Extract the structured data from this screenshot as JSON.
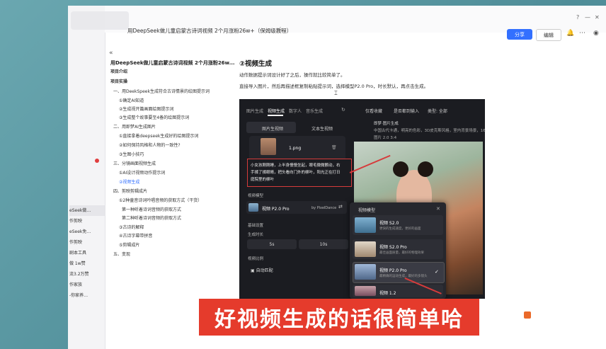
{
  "header": {
    "doc_title": "用DeepSeek做儿童启蒙古诗词视频 2个月涨粉26w+（保姆级教程）",
    "share": "分享",
    "edit": "编辑"
  },
  "sidebar": {
    "items": [
      "eSeek做…",
      "作剪映",
      "eSeek免…",
      "作剪映",
      "剧本工具",
      "做 1w赞",
      "流3.2万赞",
      "作家族",
      "-你家养…"
    ]
  },
  "toc": {
    "title": "用DeepSeek做儿童启蒙古诗词视频 2个月涨粉26w...",
    "items": [
      {
        "text": "项目介绍",
        "style": "bold"
      },
      {
        "text": "项目实操",
        "style": "bold"
      },
      {
        "text": "一、用DeekSpeek生成符合古诗情景的绘图提示词",
        "style": ""
      },
      {
        "text": "①确定AI知道",
        "style": ""
      },
      {
        "text": "②生成视开篇画面绘图提示词",
        "style": ""
      },
      {
        "text": "③生成整个故事要至4备的绘图提示词",
        "style": ""
      },
      {
        "text": "二、用即梦AI生成图片",
        "style": ""
      },
      {
        "text": "①直接拿着deepseek生成好的绘图提示词",
        "style": ""
      },
      {
        "text": "②如何保持风格和人物的一致性?",
        "style": ""
      },
      {
        "text": "③生图小技巧",
        "style": ""
      },
      {
        "text": "三、分镜画面视频生成",
        "style": ""
      },
      {
        "text": "①AI设计视频动作提示词",
        "style": ""
      },
      {
        "text": "②视频生成",
        "style": "active"
      },
      {
        "text": "四、剪映剪辑成片",
        "style": ""
      },
      {
        "text": "①2种童音诗词吟唱音频的获取方式（干货）",
        "style": ""
      },
      {
        "text": "第一种听着诗词音频的获取方式",
        "style": ""
      },
      {
        "text": "第二种听着诗词音频的获取方式",
        "style": ""
      },
      {
        "text": "③古诗的解释",
        "style": ""
      },
      {
        "text": "④古诗字幕带拼音",
        "style": ""
      },
      {
        "text": "⑤剪辑成片",
        "style": ""
      },
      {
        "text": "五、变现",
        "style": ""
      }
    ]
  },
  "content": {
    "heading": "②视频生成",
    "para1": "动作数据提示词设计好了之后，操作就比较简单了。",
    "para2": "直接导入图片，然后再描述框复制粘贴提示词，选择模型P2.0 Pro，时长默认，再点击生成。"
  },
  "shot": {
    "tabs": [
      "图片生成",
      "视频生成",
      "数字人",
      "音乐生成"
    ],
    "subtabs": [
      "图片生视频",
      "文本生视频"
    ],
    "file": "1.png",
    "prompt_lines": [
      "小女孩刚刚睡，上半身慢慢坐起，眼毛微微颤动，右",
      "手揉了揉眼睛，把头看向门外的柳叶，阳光正在打日",
      "庭院里的柳叶"
    ],
    "model_label": "视频模型",
    "model_name": "视频 P2.0 Pro",
    "model_by": "by PixelDance",
    "basic_settings": "基础设置",
    "duration_label": "生成时长",
    "durations": [
      "5s",
      "10s"
    ],
    "ratio_label": "视频比例",
    "auto_match": "自动匹配",
    "feed_tabs": [
      "仅看收藏",
      "是否都到输入",
      "类型: 全部"
    ],
    "feed_user": "即梦·图片生成",
    "feed_desc": "中国古代卡通，明亮的色彩，3D皮克斯风格，室内背景场景，16",
    "feed_meta": "图片 2.0   3:4",
    "popup_title": "视频模型",
    "popup_items": [
      {
        "name": "视频 S2.0",
        "desc": "更快的生成速度，更好的画面"
      },
      {
        "name": "视频 S2.0 Pro",
        "desc": "最佳画面质量，最好的物理效果"
      },
      {
        "name": "视频 P2.0 Pro",
        "desc": "最精确的运动生成，最好的多镜头"
      },
      {
        "name": "视频 1.2",
        "desc": ""
      }
    ]
  },
  "caption": "好视频生成的话很简单哈",
  "colors": {
    "accent": "#3370ff",
    "caption_bg": "#e53b2c",
    "highlight": "#d63b3b"
  }
}
